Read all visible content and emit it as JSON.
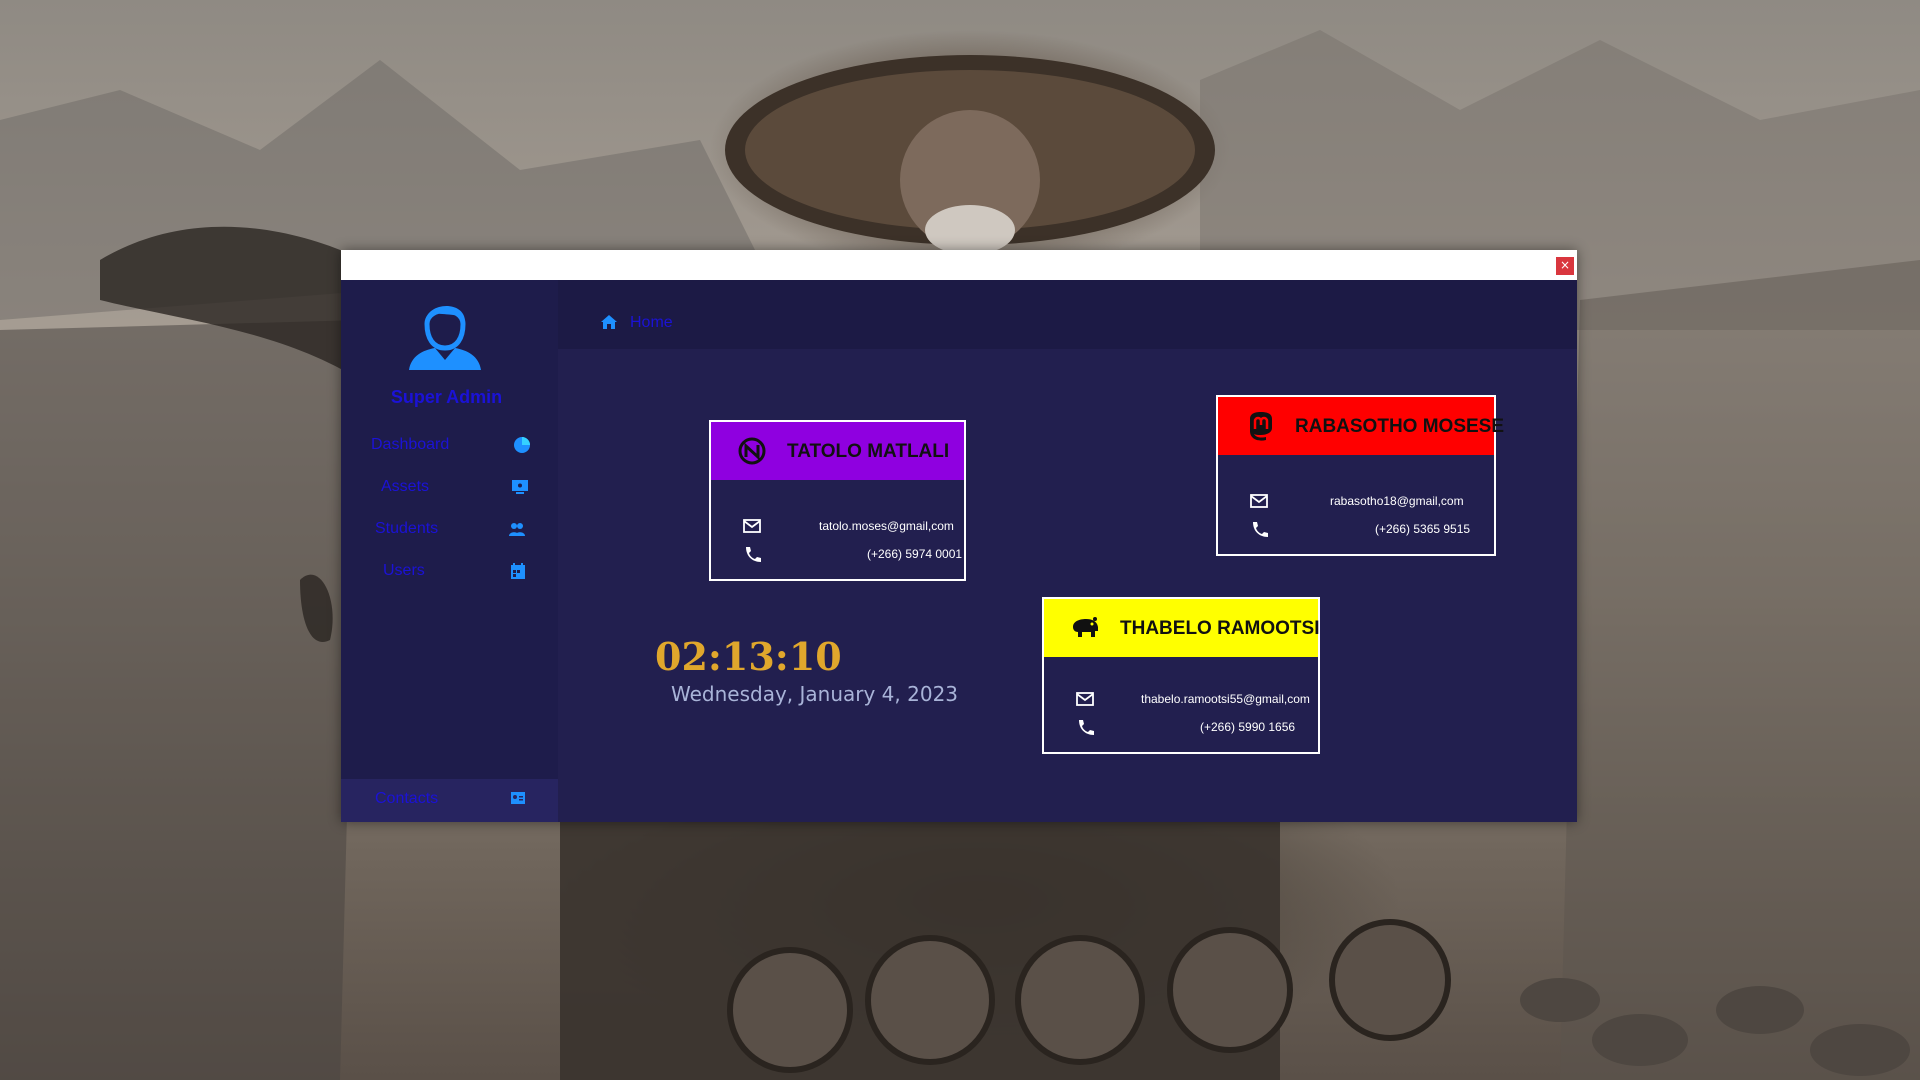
{
  "window": {
    "close_label": "×"
  },
  "sidebar": {
    "role": "Super Admin",
    "items": [
      {
        "label": "Dashboard",
        "icon": "pie-chart-icon"
      },
      {
        "label": "Assets",
        "icon": "monitor-icon"
      },
      {
        "label": "Students",
        "icon": "users-icon"
      },
      {
        "label": "Users",
        "icon": "calendar-icon"
      }
    ],
    "contacts": {
      "label": "Contacts",
      "icon": "contact-card-icon"
    }
  },
  "topbar": {
    "home_label": "Home",
    "icon": "home-icon"
  },
  "clock": {
    "time": "02:13:10",
    "date": "Wednesday, January 4, 2023"
  },
  "contacts": [
    {
      "name": "TATOLO MATLALI",
      "email": "tatolo.moses@gmail,com",
      "phone": "(+266) 5974 0001",
      "color": "#8f00e0",
      "icon": "nokia-style-n-icon"
    },
    {
      "name": "RABASOTHO MOSESE",
      "email": "rabasotho18@gmail,com",
      "phone": "(+266) 5365 9515",
      "color": "#ff0000",
      "icon": "mastodon-icon"
    },
    {
      "name": "THABELO RAMOOTSI",
      "email": "thabelo.ramootsi55@gmail,com",
      "phone": "(+266) 5990 1656",
      "color": "#ffff00",
      "icon": "hippo-icon"
    }
  ],
  "colors": {
    "accent": "#1b12d6",
    "clock": "#e0a72c",
    "window_bg": "#221f4f"
  }
}
